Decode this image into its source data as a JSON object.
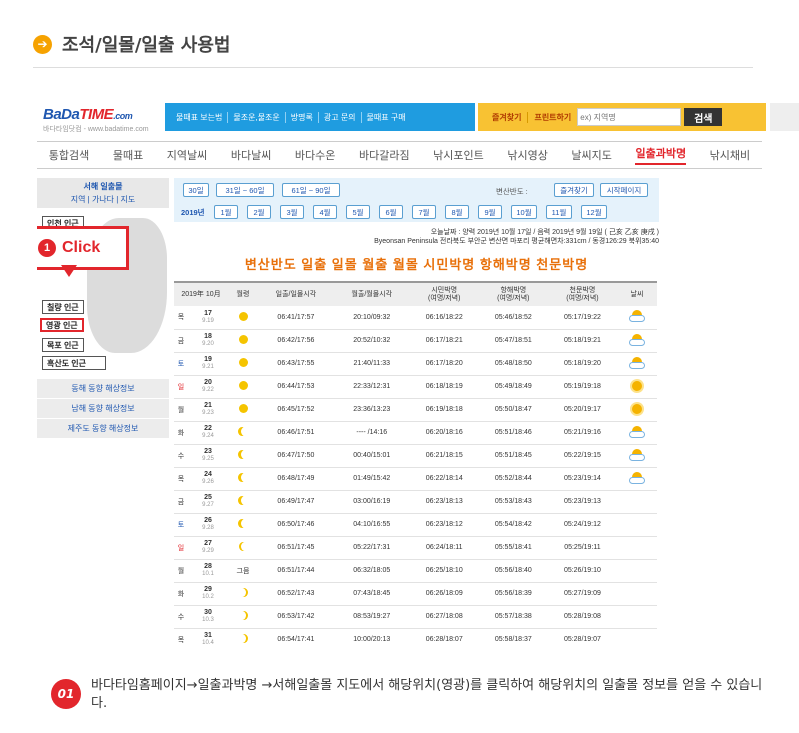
{
  "heading": {
    "title": "조석/일몰/일출 사용법",
    "icon": "arrow-right-icon"
  },
  "site": {
    "logo_main": "BaDa",
    "logo_accent": "TIME",
    "logo_suffix": ".com",
    "logo_sub": "바다타임닷컴 - www.badatime.com",
    "blue_nav": [
      "물때표 보는법",
      "물조운,물조운",
      "방명록",
      "광고 문의",
      "물때표 구매"
    ],
    "yellow_nav": [
      "즐겨찾기",
      "프린트하기"
    ],
    "search_placeholder": "ex) 지역명",
    "search_button": "검색",
    "menu": [
      "통합검색",
      "물때표",
      "지역날씨",
      "바다날씨",
      "바다수온",
      "바다갈라짐",
      "낚시포인트",
      "낚시영상",
      "날씨지도",
      "일출과박명",
      "낚시채비"
    ],
    "active_menu": "일출과박명"
  },
  "left": {
    "title": "서해 일출몰",
    "subnav": "지역 | 가나다 | 지도",
    "map_buttons": [
      "인천 인근",
      "칠량 인근",
      "영광 인근",
      "목포 인근",
      "흑산도 인근"
    ],
    "highlight": "영광 인근",
    "region_links": [
      "동해 동향 해상정보",
      "남해 동향 해상정보",
      "제주도 동향 해상정보"
    ]
  },
  "callout": {
    "num": "1",
    "text": "Click"
  },
  "filter": {
    "ranges": [
      "30일",
      "31일 ~ 60일",
      "61일 ~ 90일"
    ],
    "label": "변산반도 :",
    "right_buttons": [
      "즐겨찾기",
      "시작페이지"
    ],
    "year": "2019년",
    "months": [
      "1월",
      "2월",
      "3월",
      "4월",
      "5월",
      "6월",
      "7월",
      "8월",
      "9월",
      "10월",
      "11월",
      "12월"
    ]
  },
  "info": {
    "line1": "오늘날짜 : 양력 2019년 10월 17일 / 음력 2019년 9월 19일 ( 己亥 乙亥 庚戌 )",
    "line2": "Byeonsan Peninsula 전라북도 부안군 변산면 마포리 평균해면차:331cm / 동경126:29 북위35:40"
  },
  "big_title": "변산반도 일출 일몰 월출 월몰 시민박명 항해박명 천문박명",
  "table": {
    "headers": [
      "2019年 10月",
      "월령",
      "일출/일몰시각",
      "월출/월몰시각",
      "시민박명\n(여명/저녁)",
      "항해박명\n(여명/저녁)",
      "천문박명\n(여명/저녁)",
      "날씨"
    ],
    "rows": [
      {
        "wd": "목",
        "day": "17",
        "lunar": "9.19",
        "moon": "full",
        "sun": "06:41/17:57",
        "mn": "20:10/09:32",
        "civil": "06:16/18:22",
        "naut": "05:46/18:52",
        "astro": "05:17/19:22",
        "weather": "partly-cloudy-icon"
      },
      {
        "wd": "금",
        "day": "18",
        "lunar": "9.20",
        "moon": "full",
        "sun": "06:42/17:56",
        "mn": "20:52/10:32",
        "civil": "06:17/18:21",
        "naut": "05:47/18:51",
        "astro": "05:18/19:21",
        "weather": "partly-cloudy-icon"
      },
      {
        "wd": "토",
        "day": "19",
        "lunar": "9.21",
        "moon": "full",
        "sun": "06:43/17:55",
        "mn": "21:40/11:33",
        "civil": "06:17/18:20",
        "naut": "05:48/18:50",
        "astro": "05:18/19:20",
        "weather": "partly-cloudy-icon"
      },
      {
        "wd": "일",
        "day": "20",
        "lunar": "9.22",
        "moon": "half",
        "sun": "06:44/17:53",
        "mn": "22:33/12:31",
        "civil": "06:18/18:19",
        "naut": "05:49/18:49",
        "astro": "05:19/19:18",
        "weather": "sunny-icon"
      },
      {
        "wd": "월",
        "day": "21",
        "lunar": "9.23",
        "moon": "half",
        "sun": "06:45/17:52",
        "mn": "23:36/13:23",
        "civil": "06:19/18:18",
        "naut": "05:50/18:47",
        "astro": "05:20/19:17",
        "weather": "sunny-icon"
      },
      {
        "wd": "화",
        "day": "22",
        "lunar": "9.24",
        "moon": "crescent",
        "sun": "06:46/17:51",
        "mn": "---- /14:16",
        "civil": "06:20/18:16",
        "naut": "05:51/18:46",
        "astro": "05:21/19:16",
        "weather": "partly-cloudy-icon"
      },
      {
        "wd": "수",
        "day": "23",
        "lunar": "9.25",
        "moon": "crescent",
        "sun": "06:47/17:50",
        "mn": "00:40/15:01",
        "civil": "06:21/18:15",
        "naut": "05:51/18:45",
        "astro": "05:22/19:15",
        "weather": "partly-cloudy-icon"
      },
      {
        "wd": "목",
        "day": "24",
        "lunar": "9.26",
        "moon": "crescent",
        "sun": "06:48/17:49",
        "mn": "01:49/15:42",
        "civil": "06:22/18:14",
        "naut": "05:52/18:44",
        "astro": "05:23/19:14",
        "weather": "partly-cloudy-icon"
      },
      {
        "wd": "금",
        "day": "25",
        "lunar": "9.27",
        "moon": "crescent",
        "sun": "06:49/17:47",
        "mn": "03:00/16:19",
        "civil": "06:23/18:13",
        "naut": "05:53/18:43",
        "astro": "05:23/19:13",
        "weather": ""
      },
      {
        "wd": "토",
        "day": "26",
        "lunar": "9.28",
        "moon": "crescent",
        "sun": "06:50/17:46",
        "mn": "04:10/16:55",
        "civil": "06:23/18:12",
        "naut": "05:54/18:42",
        "astro": "05:24/19:12",
        "weather": ""
      },
      {
        "wd": "일",
        "day": "27",
        "lunar": "9.29",
        "moon": "thin",
        "sun": "06:51/17:45",
        "mn": "05:22/17:31",
        "civil": "06:24/18:11",
        "naut": "05:55/18:41",
        "astro": "05:25/19:11",
        "weather": ""
      },
      {
        "wd": "월",
        "day": "28",
        "lunar": "10.1",
        "moon": "new",
        "sun": "06:51/17:44",
        "mn": "06:32/18:05",
        "civil": "06:25/18:10",
        "naut": "05:56/18:40",
        "astro": "05:26/19:10",
        "weather": ""
      },
      {
        "wd": "화",
        "day": "29",
        "lunar": "10.2",
        "moon": "wax",
        "sun": "06:52/17:43",
        "mn": "07:43/18:45",
        "civil": "06:26/18:09",
        "naut": "05:56/18:39",
        "astro": "05:27/19:09",
        "weather": ""
      },
      {
        "wd": "수",
        "day": "30",
        "lunar": "10.3",
        "moon": "wax",
        "sun": "06:53/17:42",
        "mn": "08:53/19:27",
        "civil": "06:27/18:08",
        "naut": "05:57/18:38",
        "astro": "05:28/19:08",
        "weather": ""
      },
      {
        "wd": "목",
        "day": "31",
        "lunar": "10.4",
        "moon": "wax",
        "sun": "06:54/17:41",
        "mn": "10:00/20:13",
        "civil": "06:28/18:07",
        "naut": "05:58/18:37",
        "astro": "05:28/19:07",
        "weather": ""
      }
    ],
    "new_moon_label": "그믐"
  },
  "note": {
    "num": "01",
    "text": "바다타임홈페이지→일출과박명 →서해일출몰 지도에서 해당위치(영광)를 클릭하여 해당위치의 일출몰 정보를 얻을 수 있습니다."
  }
}
